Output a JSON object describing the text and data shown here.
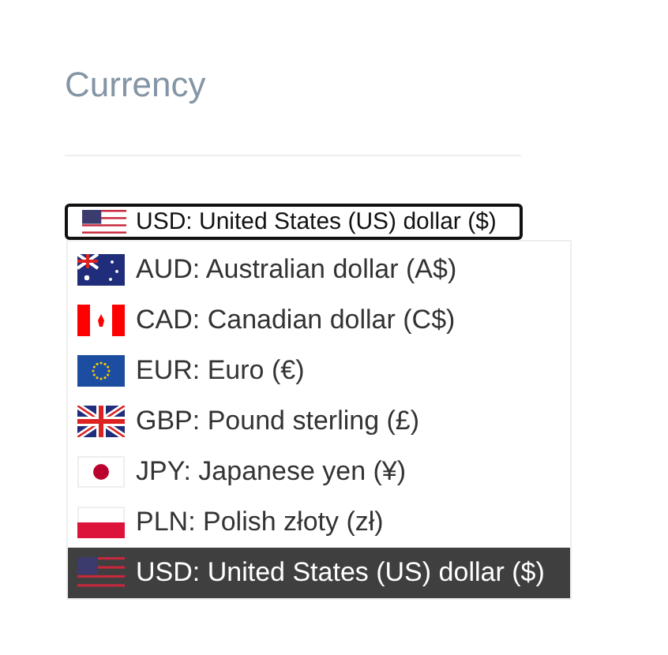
{
  "title": "Currency",
  "select": {
    "value": "USD: United States (US) dollar ($)",
    "kind": "us"
  },
  "options": [
    {
      "label": "AUD: Australian dollar (A$)",
      "kind": "au",
      "selected": false
    },
    {
      "label": "CAD: Canadian dollar (C$)",
      "kind": "ca",
      "selected": false
    },
    {
      "label": "EUR: Euro (€)",
      "kind": "eu",
      "selected": false
    },
    {
      "label": "GBP: Pound sterling (£)",
      "kind": "gb",
      "selected": false
    },
    {
      "label": "JPY: Japanese yen (¥)",
      "kind": "jp",
      "selected": false
    },
    {
      "label": "PLN: Polish złoty (zł)",
      "kind": "pl",
      "selected": false
    },
    {
      "label": "USD: United States (US) dollar ($)",
      "kind": "us",
      "selected": true
    }
  ]
}
